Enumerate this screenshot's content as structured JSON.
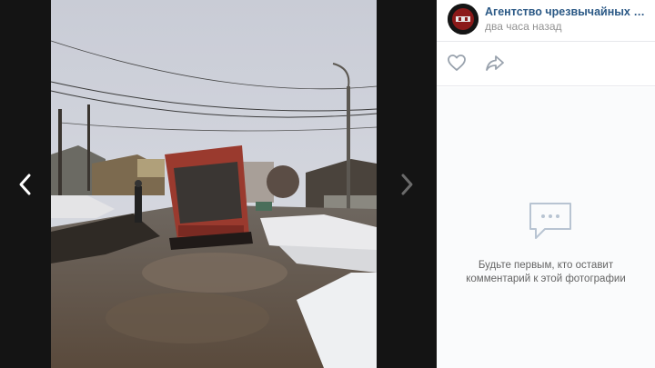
{
  "post": {
    "author": "Агентство чрезвычайных новостей",
    "time": "два часа назад"
  },
  "comments": {
    "empty_line1": "Будьте первым, кто оставит",
    "empty_line2": "комментарий к этой фотографии"
  },
  "colors": {
    "link": "#2a5885",
    "muted": "#939393",
    "icon": "#99a2ad",
    "viewer_bg": "#141414"
  },
  "icons": {
    "prev": "chevron-left-icon",
    "next": "chevron-right-icon",
    "like": "heart-icon",
    "share": "share-arrow-icon",
    "empty": "comment-bubble-icon"
  }
}
